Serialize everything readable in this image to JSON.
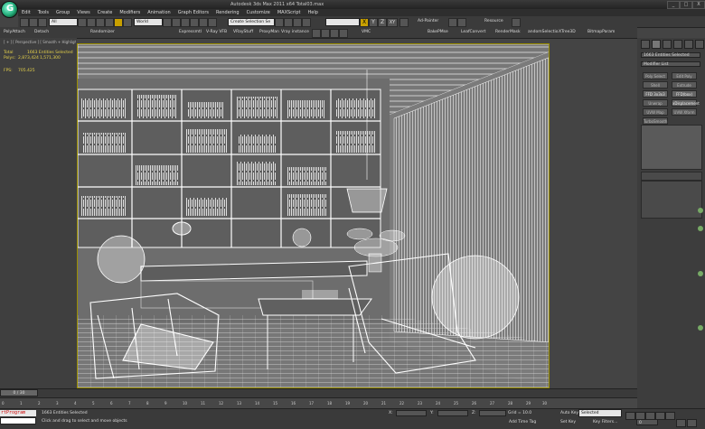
{
  "window": {
    "title": "Autodesk 3ds Max  2011 x64      Total03.max",
    "controls": [
      "_",
      "□",
      "X"
    ]
  },
  "menu": [
    "Edit",
    "Tools",
    "Group",
    "Views",
    "Create",
    "Modifiers",
    "Animation",
    "Graph Editors",
    "Rendering",
    "Customize",
    "MAXScript",
    "Help"
  ],
  "toolbar1": {
    "selection_filter": "All",
    "reference_coord": "World",
    "named_selection_placeholder": "Create Selection Se",
    "axis_labels": [
      "X",
      "Y",
      "Z",
      "XY"
    ],
    "ad_painter": "Ad-Painter",
    "resource": "Resource"
  },
  "toolbar2": [
    "PolyAttach",
    "Detach",
    "Randomizer",
    "Expressmtl",
    "V-Ray VFB",
    "VRayStuff",
    "ProxyMan",
    "Vray instance",
    "VMC",
    "BakePMse",
    "LeafConvert",
    "RenderMask",
    "andomSelectio",
    "XTree3D",
    "BitmapParam"
  ],
  "viewport": {
    "label": "[ + ] [ Perspective ] [ Smooth + Highlights + Edged Faces ]",
    "stats": {
      "total_label": "Total",
      "total_value": "1663 Entities Selected",
      "polys_label": "Polys:",
      "polys_value": "2,873,424",
      "polys_selected": "1,571,300",
      "fps_label": "FPS:",
      "fps_value": "705.425"
    }
  },
  "command_panel": {
    "object_name": "1663 Entities Selected",
    "modifier_list": "Modifier List",
    "buttons": [
      "Poly Select",
      "Edit Poly",
      "Shell",
      "Extrude",
      "FFD 3x3x3",
      "FFD(box)",
      "Unwrap UVW",
      "xDisplacement",
      "UVW Map",
      "UVW Xform",
      "TurboSmooth"
    ]
  },
  "timeline": {
    "slider": "0 / 30",
    "ticks": [
      "0",
      "1",
      "2",
      "3",
      "4",
      "5",
      "6",
      "7",
      "8",
      "9",
      "10",
      "11",
      "12",
      "13",
      "14",
      "15",
      "16",
      "17",
      "18",
      "19",
      "20",
      "21",
      "22",
      "23",
      "24",
      "25",
      "26",
      "27",
      "28",
      "29",
      "30"
    ]
  },
  "status": {
    "listener": "rtProgram",
    "selected": "1663 Entities Selected",
    "prompt": "Click and drag to select and move objects",
    "x_label": "X:",
    "y_label": "Y:",
    "z_label": "Z:",
    "grid": "Grid = 10.0",
    "auto_key": "Auto Key",
    "set_key": "Set Key",
    "key_mode": "Selected",
    "key_filters": "Key Filters...",
    "add_time_tag": "Add Time Tag",
    "frame": "0"
  }
}
